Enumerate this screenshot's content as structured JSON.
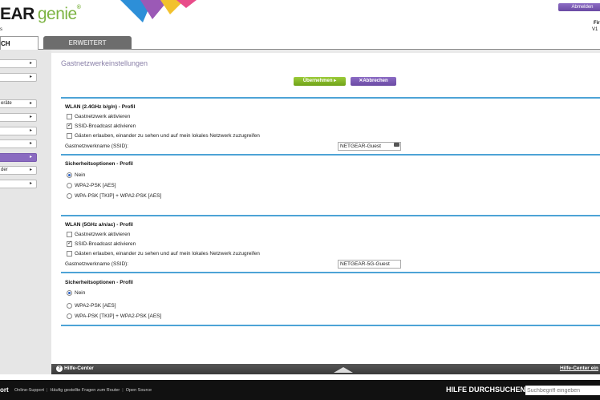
{
  "header": {
    "logo_part1": "EAR",
    "logo_part2": "genie",
    "logo_reg": "®",
    "logo_sub": "s",
    "logout_label": "Abmelden",
    "fw_label": "Fir",
    "fw_version": "V1"
  },
  "tabs": {
    "basic": "CH",
    "advanced": "ERWEITERT"
  },
  "sidebar": {
    "items": [
      {
        "label": ""
      },
      {
        "label": ""
      },
      {
        "label": "eräte"
      },
      {
        "label": ""
      },
      {
        "label": ""
      },
      {
        "label": ""
      },
      {
        "label": "",
        "active": true
      },
      {
        "label": "der"
      },
      {
        "label": ""
      }
    ],
    "arrow": "▸"
  },
  "main": {
    "title": "Gastnetzwerkeinstellungen",
    "apply_label": "Übernehmen ▸",
    "cancel_label": "✕Abbrechen",
    "band24": {
      "title": "WLAN (2.4GHz b/g/n) - Profil",
      "enable_guest": "Gastnetzwerk aktivieren",
      "enable_guest_checked": false,
      "ssid_broadcast": "SSID-Broadcast aktivieren",
      "ssid_broadcast_checked": true,
      "allow_local": "Gästen erlauben, einander zu sehen und auf mein lokales Netzwerk zuzugreifen",
      "allow_local_checked": false,
      "ssid_label": "Gastnetzwerkname (SSID):",
      "ssid_value": "NETGEAR-Guest",
      "security_title": "Sicherheitsoptionen - Profil",
      "opt_none": "Nein",
      "opt_wpa2": "WPA2-PSK [AES]",
      "opt_mixed": "WPA-PSK [TKIP] + WPA2-PSK [AES]",
      "selected": "none"
    },
    "band5": {
      "title": "WLAN (5GHz a/n/ac) - Profil",
      "enable_guest": "Gastnetzwerk aktivieren",
      "enable_guest_checked": false,
      "ssid_broadcast": "SSID-Broadcast aktivieren",
      "ssid_broadcast_checked": true,
      "allow_local": "Gästen erlauben, einander zu sehen und auf mein lokales Netzwerk zuzugreifen",
      "allow_local_checked": false,
      "ssid_label": "Gastnetzwerkname (SSID):",
      "ssid_value": "NETGEAR-5G-Guest",
      "security_title": "Sicherheitsoptionen - Profil",
      "opt_none": "Nein",
      "opt_wpa2": "WPA2-PSK [AES]",
      "opt_mixed": "WPA-PSK [TKIP] + WPA2-PSK [AES]",
      "selected": "none"
    }
  },
  "helpbar": {
    "left_label": "Hilfe-Center",
    "right_label": "Hilfe-Center ein"
  },
  "footer": {
    "support": "ort",
    "links": [
      "Online-Support",
      "Häufig gestellte Fragen zum Router",
      "Open Source"
    ],
    "search_label": "HILFE DURCHSUCHEN",
    "search_placeholder": "Suchbegriff eingeben"
  },
  "colors": {
    "accent_purple": "#7a5bb0",
    "accent_green": "#7cb342",
    "section_line": "#4da3d6"
  }
}
